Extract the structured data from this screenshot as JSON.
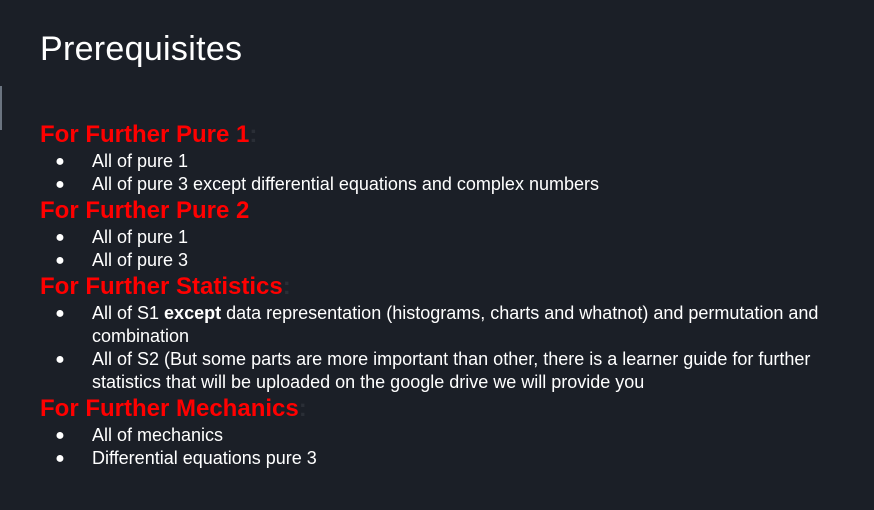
{
  "slide": {
    "title": "Prerequisites",
    "sections": [
      {
        "heading": "For Further Pure 1",
        "colon": ":",
        "items": [
          {
            "text": "All of pure 1"
          },
          {
            "text": "All of pure 3 except differential equations and complex numbers"
          }
        ]
      },
      {
        "heading": "For Further Pure 2",
        "colon": "",
        "items": [
          {
            "text": "All of pure 1"
          },
          {
            "text": "All of pure 3"
          }
        ]
      },
      {
        "heading": "For Further Statistics",
        "colon": ":",
        "items": [
          {
            "before": "All of S1 ",
            "emphasis": "except",
            "after": " data representation (histograms, charts and whatnot) and permutation and combination"
          },
          {
            "text": "All of S2 (But some parts are more important than other, there is a learner guide for further statistics that will be uploaded on the google drive we will provide you"
          }
        ]
      },
      {
        "heading": "For Further Mechanics",
        "colon": ":",
        "items": [
          {
            "text": "All of mechanics"
          },
          {
            "text": "Differential equations pure 3"
          }
        ]
      }
    ]
  },
  "bullet_glyph": "●",
  "colors": {
    "background": "#1b1f27",
    "heading": "#ff0000",
    "text": "#ffffff"
  }
}
